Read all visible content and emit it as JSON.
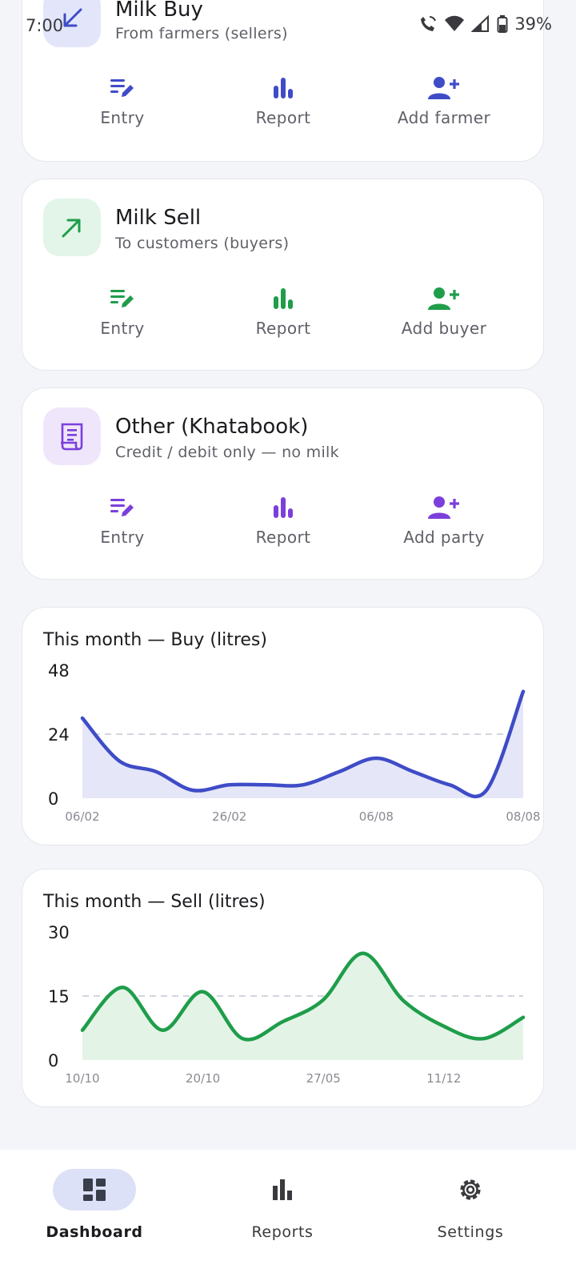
{
  "status": {
    "time": "7:00",
    "battery": "39%"
  },
  "modules": [
    {
      "title": "Milk Buy",
      "subtitle": "From farmers (sellers)",
      "accent": "#3f4cc7",
      "icon_bg": "#e3e6fa",
      "actions": [
        "Entry",
        "Report",
        "Add farmer"
      ]
    },
    {
      "title": "Milk Sell",
      "subtitle": "To customers (buyers)",
      "accent": "#1f9d4a",
      "icon_bg": "#e2f5e8",
      "actions": [
        "Entry",
        "Report",
        "Add buyer"
      ]
    },
    {
      "title": "Other (Khatabook)",
      "subtitle": "Credit / debit only — no milk",
      "accent": "#7b3fdc",
      "icon_bg": "#efe6fb",
      "actions": [
        "Entry",
        "Report",
        "Add party"
      ]
    }
  ],
  "chart_data": [
    {
      "type": "area",
      "title": "This month — Buy (litres)",
      "color": "#3f4cc7",
      "fill": "#e5e7f8",
      "ylim": [
        0,
        48
      ],
      "yticks": [
        "48",
        "24",
        "0"
      ],
      "xticks": [
        "06/02",
        "26/02",
        "06/08",
        "08/08"
      ],
      "values": [
        30,
        14,
        10,
        3,
        5,
        5,
        5,
        10,
        15,
        10,
        5,
        3,
        40
      ]
    },
    {
      "type": "area",
      "title": "This month — Sell (litres)",
      "color": "#1f9d4a",
      "fill": "#e3f4e7",
      "ylim": [
        0,
        30
      ],
      "yticks": [
        "30",
        "15",
        "0"
      ],
      "xticks": [
        "10/10",
        "20/10",
        "27/05",
        "11/12"
      ],
      "values": [
        7,
        17,
        7,
        16,
        5,
        9,
        14,
        25,
        14,
        8,
        5,
        10
      ]
    }
  ],
  "nav": [
    {
      "label": "Dashboard",
      "active": true
    },
    {
      "label": "Reports",
      "active": false
    },
    {
      "label": "Settings",
      "active": false
    }
  ]
}
